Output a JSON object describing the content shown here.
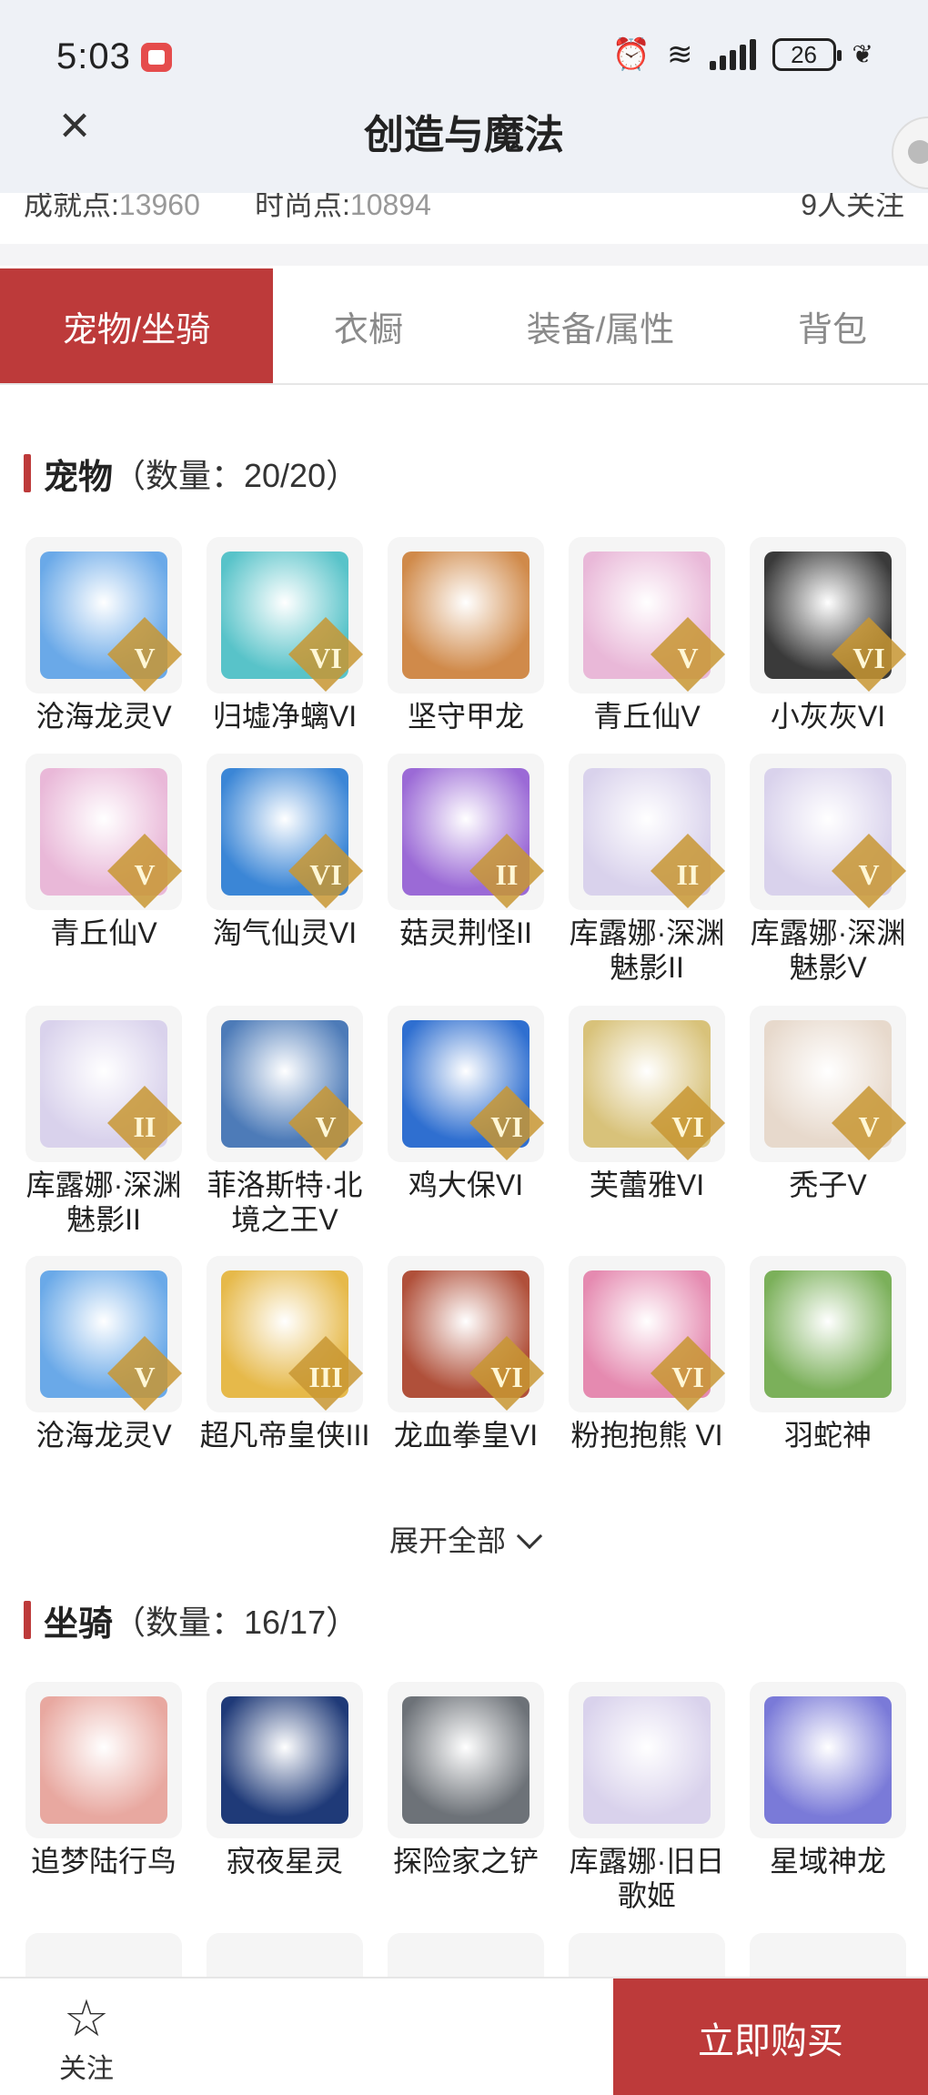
{
  "status_bar": {
    "time": "5:03",
    "battery": "26",
    "icons": [
      "alarm-icon",
      "wifi-icon",
      "signal-icon",
      "battery-icon",
      "leaf-icon"
    ]
  },
  "header": {
    "title": "创造与魔法",
    "close_icon": "close-icon"
  },
  "stats": {
    "achievement_label": "成就点:",
    "achievement_value": "13960",
    "fashion_label": "时尚点:",
    "fashion_value": "10894",
    "followers": "9人关注"
  },
  "tabs": [
    {
      "label": "宠物/坐骑",
      "active": true
    },
    {
      "label": "衣橱",
      "active": false
    },
    {
      "label": "装备/属性",
      "active": false
    },
    {
      "label": "背包",
      "active": false
    }
  ],
  "pets_section": {
    "title": "宠物",
    "count": "（数量：20/20）",
    "items": [
      {
        "name": "沧海龙灵V",
        "badge": "V",
        "color": "#6aa9e8"
      },
      {
        "name": "归墟净螭VI",
        "badge": "VI",
        "color": "#58c3c9"
      },
      {
        "name": "坚守甲龙",
        "badge": "",
        "color": "#d08a4a"
      },
      {
        "name": "青丘仙V",
        "badge": "V",
        "color": "#e9b8d8"
      },
      {
        "name": "小灰灰VI",
        "badge": "VI",
        "color": "#3a3a3a"
      },
      {
        "name": "青丘仙V",
        "badge": "V",
        "color": "#e9b8d8"
      },
      {
        "name": "淘气仙灵VI",
        "badge": "VI",
        "color": "#3b86d6"
      },
      {
        "name": "菇灵荆怪II",
        "badge": "II",
        "color": "#9b6ad6"
      },
      {
        "name": "库露娜·深渊魅影II",
        "badge": "II",
        "color": "#d9d2ec"
      },
      {
        "name": "库露娜·深渊魅影V",
        "badge": "V",
        "color": "#d9d2ec"
      },
      {
        "name": "库露娜·深渊魅影II",
        "badge": "II",
        "color": "#d9d2ec"
      },
      {
        "name": "菲洛斯特·北境之王V",
        "badge": "V",
        "color": "#4d7bb8"
      },
      {
        "name": "鸡大保VI",
        "badge": "VI",
        "color": "#2f6fd0"
      },
      {
        "name": "芙蕾雅VI",
        "badge": "VI",
        "color": "#d8c27a"
      },
      {
        "name": "秃子V",
        "badge": "V",
        "color": "#e7d9cc"
      },
      {
        "name": "沧海龙灵V",
        "badge": "V",
        "color": "#6aa9e8"
      },
      {
        "name": "超凡帝皇侠III",
        "badge": "III",
        "color": "#e6b94a"
      },
      {
        "name": "龙血拳皇VI",
        "badge": "VI",
        "color": "#b0503a"
      },
      {
        "name": "粉抱抱熊 VI",
        "badge": "VI",
        "color": "#e58ab0"
      },
      {
        "name": "羽蛇神",
        "badge": "",
        "color": "#7bb05a"
      }
    ]
  },
  "expand_label": "展开全部",
  "mounts_section": {
    "title": "坐骑",
    "count": "（数量：16/17）",
    "items": [
      {
        "name": "追梦陆行鸟",
        "color": "#e8a8a0"
      },
      {
        "name": "寂夜星灵",
        "color": "#1f3a78"
      },
      {
        "name": "探险家之铲",
        "color": "#6d7278"
      },
      {
        "name": "库露娜·旧日歌姬",
        "color": "#d9d2ec"
      },
      {
        "name": "星域神龙",
        "color": "#7a7ad8"
      }
    ]
  },
  "bottom_bar": {
    "follow_label": "关注",
    "follow_icon": "star-outline-icon",
    "buy_label": "立即购买"
  }
}
